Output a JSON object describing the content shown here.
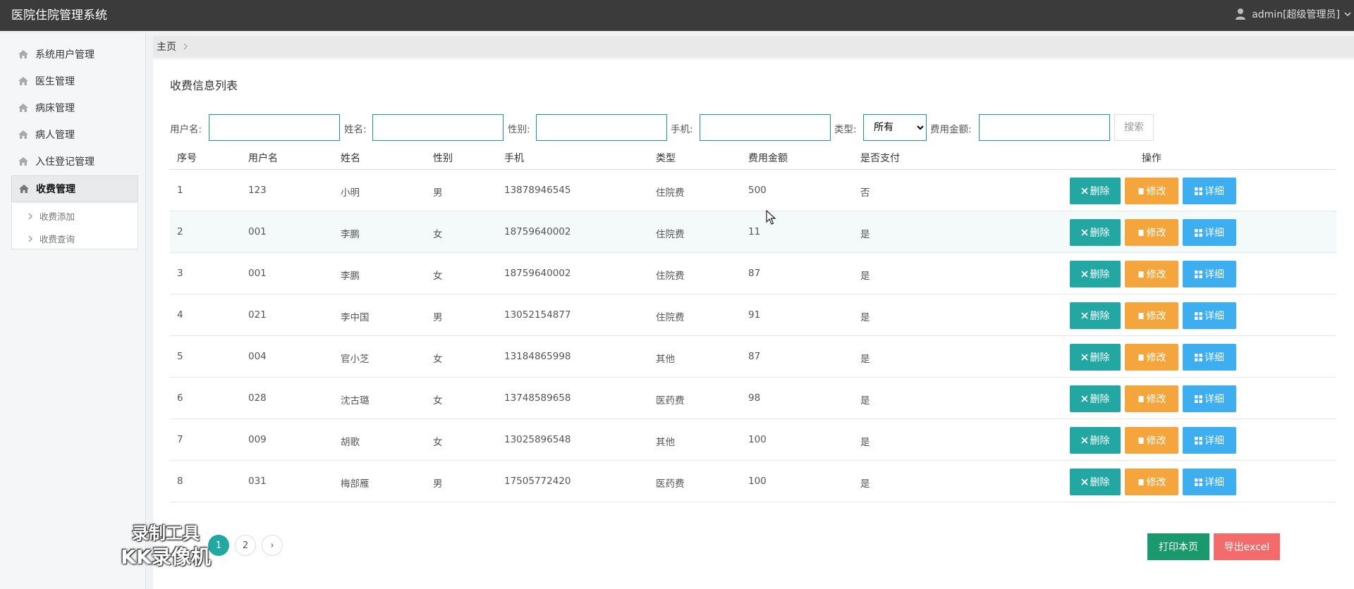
{
  "app": {
    "title": "医院住院管理系统",
    "user": "admin[超级管理员]"
  },
  "sidebar": {
    "items": [
      {
        "label": "系统用户管理"
      },
      {
        "label": "医生管理"
      },
      {
        "label": "病床管理"
      },
      {
        "label": "病人管理"
      },
      {
        "label": "入住登记管理"
      },
      {
        "label": "收费管理"
      }
    ],
    "sub_items": [
      {
        "label": "收费添加"
      },
      {
        "label": "收费查询"
      }
    ]
  },
  "breadcrumb": {
    "home": "主页"
  },
  "page": {
    "heading": "收费信息列表"
  },
  "search": {
    "username_label": "用户名:",
    "name_label": "姓名:",
    "gender_label": "性别:",
    "phone_label": "手机:",
    "type_label": "类型:",
    "type_selected": "所有",
    "amount_label": "费用金额:",
    "button": "搜索"
  },
  "table": {
    "headers": {
      "no": "序号",
      "username": "用户名",
      "name": "姓名",
      "gender": "性别",
      "phone": "手机",
      "type": "类型",
      "amount": "费用金额",
      "paid": "是否支付",
      "ops": "操作"
    },
    "actions": {
      "delete": "删除",
      "edit": "修改",
      "detail": "详细"
    },
    "rows": [
      {
        "no": "1",
        "username": "123",
        "name": "小明",
        "gender": "男",
        "phone": "13878946545",
        "type": "住院费",
        "amount": "500",
        "paid": "否"
      },
      {
        "no": "2",
        "username": "001",
        "name": "李鹏",
        "gender": "女",
        "phone": "18759640002",
        "type": "住院费",
        "amount": "11",
        "paid": "是"
      },
      {
        "no": "3",
        "username": "001",
        "name": "李鹏",
        "gender": "女",
        "phone": "18759640002",
        "type": "住院费",
        "amount": "87",
        "paid": "是"
      },
      {
        "no": "4",
        "username": "021",
        "name": "李中国",
        "gender": "男",
        "phone": "13052154877",
        "type": "住院费",
        "amount": "91",
        "paid": "是"
      },
      {
        "no": "5",
        "username": "004",
        "name": "官小芝",
        "gender": "女",
        "phone": "13184865998",
        "type": "其他",
        "amount": "87",
        "paid": "是"
      },
      {
        "no": "6",
        "username": "028",
        "name": "沈古璐",
        "gender": "女",
        "phone": "13748589658",
        "type": "医药费",
        "amount": "98",
        "paid": "是"
      },
      {
        "no": "7",
        "username": "009",
        "name": "胡歌",
        "gender": "女",
        "phone": "13025896548",
        "type": "其他",
        "amount": "100",
        "paid": "是"
      },
      {
        "no": "8",
        "username": "031",
        "name": "梅部雁",
        "gender": "男",
        "phone": "17505772420",
        "type": "医药费",
        "amount": "100",
        "paid": "是"
      }
    ]
  },
  "pagination": {
    "pages": [
      "1",
      "2"
    ],
    "current": "1",
    "next": "›"
  },
  "footer": {
    "print": "打印本页",
    "export": "导出excel"
  },
  "watermark": {
    "line1": "录制工具",
    "line2": "KK录像机"
  },
  "colors": {
    "teal": "#22a7a3",
    "orange": "#f4a63d",
    "blue": "#3daef0",
    "green": "#1a9a6c",
    "red": "#f36b6b"
  }
}
